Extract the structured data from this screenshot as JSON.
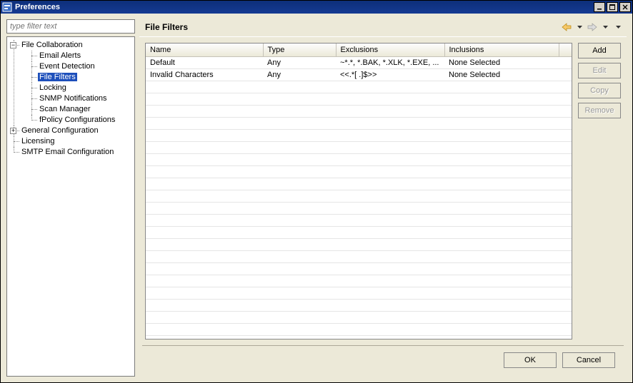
{
  "window": {
    "title": "Preferences"
  },
  "win_buttons": {
    "minimize": "_",
    "maximize": "□",
    "close": "×"
  },
  "left": {
    "filter_placeholder": "type filter text",
    "tree": {
      "file_collaboration": {
        "label": "File Collaboration",
        "expanded": true,
        "children": {
          "email_alerts": {
            "label": "Email Alerts"
          },
          "event_detection": {
            "label": "Event Detection"
          },
          "file_filters": {
            "label": "File Filters",
            "selected": true
          },
          "locking": {
            "label": "Locking"
          },
          "snmp_notifications": {
            "label": "SNMP Notifications"
          },
          "scan_manager": {
            "label": "Scan Manager"
          },
          "fpolicy_configurations": {
            "label": "fPolicy Configurations"
          }
        }
      },
      "general_configuration": {
        "label": "General Configuration",
        "expanded": false
      },
      "licensing": {
        "label": "Licensing"
      },
      "smtp_email_configuration": {
        "label": "SMTP Email Configuration"
      }
    }
  },
  "right": {
    "title": "File Filters",
    "table": {
      "columns": {
        "name": "Name",
        "type": "Type",
        "exclusions": "Exclusions",
        "inclusions": "Inclusions"
      },
      "rows": [
        {
          "name": "Default",
          "type": "Any",
          "exclusions": "~*.*, *.BAK, *.XLK, *.EXE, ...",
          "inclusions": "None Selected"
        },
        {
          "name": "Invalid Characters",
          "type": "Any",
          "exclusions": "<<.*[ .]$>>",
          "inclusions": "None Selected"
        }
      ]
    },
    "buttons": {
      "add": "Add",
      "edit": "Edit",
      "copy": "Copy",
      "remove": "Remove"
    }
  },
  "footer": {
    "ok": "OK",
    "cancel": "Cancel"
  }
}
